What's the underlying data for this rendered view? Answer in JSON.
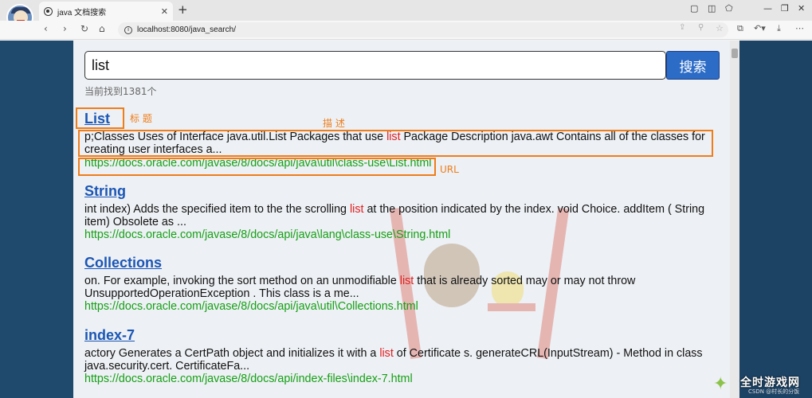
{
  "browser": {
    "tab_title": "java 文档搜索",
    "tab_close": "✕",
    "new_tab": "+",
    "url": "localhost:8080/java_search/",
    "info_glyph": "i"
  },
  "search": {
    "query": "list",
    "button_label": "搜索",
    "count_text": "当前找到1381个"
  },
  "results": [
    {
      "title": "List",
      "desc_parts": [
        "p;Classes Uses of Interface java.util.List Packages that use ",
        "list",
        "   Package Description java.awt Contains all of the classes for creating user interfaces a..."
      ],
      "url": "https://docs.oracle.com/javase/8/docs/api/java\\util\\class-use\\List.html"
    },
    {
      "title": "String",
      "desc_parts": [
        "int index) Adds the specified item to the the scrolling ",
        "list",
        " at the position indicated by the index. void Choice. addItem ( String  item) Obsolete as ..."
      ],
      "url": "https://docs.oracle.com/javase/8/docs/api/java\\lang\\class-use\\String.html"
    },
    {
      "title": "Collections",
      "desc_parts": [
        "on. For example, invoking the sort method on an unmodifiable ",
        "list",
        " that is already sorted may or may not throw UnsupportedOperationException . This class is a me..."
      ],
      "url": "https://docs.oracle.com/javase/8/docs/api/java\\util\\Collections.html"
    },
    {
      "title": "index-7",
      "desc_parts": [
        "actory Generates a CertPath object and initializes it with a ",
        "list",
        " of Certificate s. generateCRL(InputStream) - Method in class java.security.cert. CertificateFa..."
      ],
      "url": "https://docs.oracle.com/javase/8/docs/api/index-files\\index-7.html"
    }
  ],
  "annotations": {
    "title_label": "标 题",
    "desc_label": "描 述",
    "url_label": "URL",
    "color": "#ef7d1a"
  },
  "watermark": {
    "logo_text": "全时游戏网",
    "logo_sub": "CSDN @村长的分饭"
  }
}
